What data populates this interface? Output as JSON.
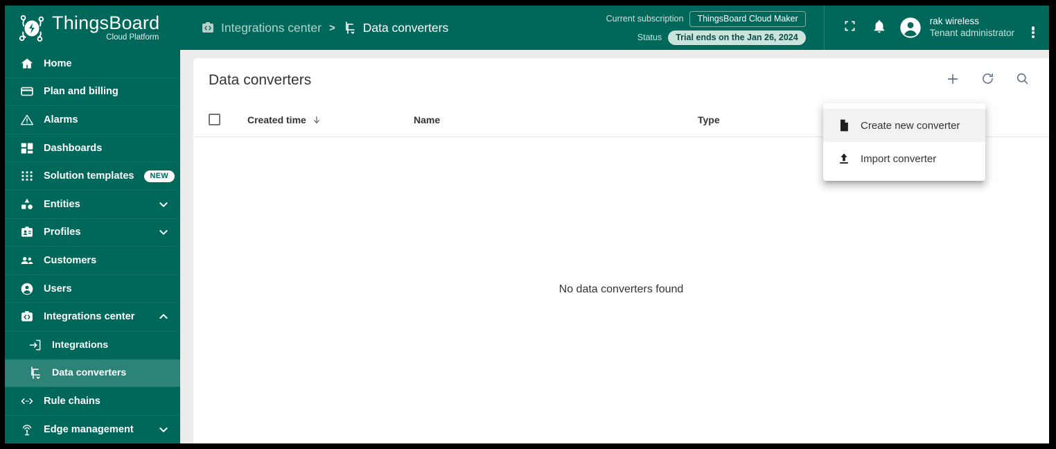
{
  "brand": {
    "title": "ThingsBoard",
    "subtitle": "Cloud Platform",
    "logo_icon": "thingsboard-bug-logo"
  },
  "header": {
    "breadcrumb": [
      {
        "label": "Integrations center",
        "icon": "integrations-center-icon",
        "active": false
      },
      {
        "separator": ">"
      },
      {
        "label": "Data converters",
        "icon": "data-converter-icon",
        "active": true
      }
    ],
    "subscription": {
      "label": "Current subscription",
      "value": "ThingsBoard Cloud Maker"
    },
    "status": {
      "label": "Status",
      "value": "Trial ends on the Jan 26, 2024"
    },
    "actions": {
      "fullscreen_icon": "fullscreen-icon",
      "notifications_icon": "bell-icon",
      "more_icon": "vertical-dots-icon"
    },
    "user": {
      "name": "rak wireless",
      "role": "Tenant administrator",
      "avatar_icon": "account-circle-icon"
    }
  },
  "sidebar": {
    "items": [
      {
        "label": "Home",
        "icon": "home-icon",
        "level": 0,
        "active": false
      },
      {
        "label": "Plan and billing",
        "icon": "credit-card-icon",
        "level": 0,
        "active": false
      },
      {
        "label": "Alarms",
        "icon": "alarm-warning-icon",
        "level": 0,
        "active": false
      },
      {
        "label": "Dashboards",
        "icon": "dashboards-icon",
        "level": 0,
        "active": false
      },
      {
        "label": "Solution templates",
        "icon": "apps-grid-icon",
        "level": 0,
        "active": false,
        "badge": "NEW"
      },
      {
        "label": "Entities",
        "icon": "entities-icon",
        "level": 0,
        "active": false,
        "chevron": "chevron-down-icon"
      },
      {
        "label": "Profiles",
        "icon": "profiles-icon",
        "level": 0,
        "active": false,
        "chevron": "chevron-down-icon"
      },
      {
        "label": "Customers",
        "icon": "customers-icon",
        "level": 0,
        "active": false
      },
      {
        "label": "Users",
        "icon": "user-circle-icon",
        "level": 0,
        "active": false
      },
      {
        "label": "Integrations center",
        "icon": "integrations-center-icon",
        "level": 0,
        "active": false,
        "chevron": "chevron-up-icon"
      },
      {
        "label": "Integrations",
        "icon": "integration-arrow-icon",
        "level": 1,
        "active": false
      },
      {
        "label": "Data converters",
        "icon": "data-converter-icon",
        "level": 1,
        "active": true
      },
      {
        "label": "Rule chains",
        "icon": "rule-chains-icon",
        "level": 0,
        "active": false
      },
      {
        "label": "Edge management",
        "icon": "edge-antenna-icon",
        "level": 0,
        "active": false,
        "chevron": "chevron-down-icon"
      }
    ]
  },
  "main": {
    "title": "Data converters",
    "toolbar": {
      "add_icon": "plus-icon",
      "refresh_icon": "refresh-icon",
      "search_icon": "search-icon"
    },
    "table": {
      "select_all_checked": false,
      "columns": [
        {
          "label": "Created time",
          "sort": "descending",
          "sort_icon": "arrow-down-icon"
        },
        {
          "label": "Name",
          "sort": "none"
        },
        {
          "label": "Type",
          "sort": "none"
        }
      ],
      "rows": [],
      "empty_message": "No data converters found"
    }
  },
  "menu": {
    "items": [
      {
        "label": "Create new converter",
        "icon": "file-document-icon",
        "hovered": true
      },
      {
        "label": "Import converter",
        "icon": "upload-icon",
        "hovered": false
      }
    ]
  },
  "colors": {
    "brand_teal": "#00675b",
    "sidebar_active": "#2e8378",
    "page_bg": "#ececec",
    "card_bg": "#ffffff",
    "status_pill_bg": "#c9e4dd",
    "tool_icon": "#5f7285"
  }
}
